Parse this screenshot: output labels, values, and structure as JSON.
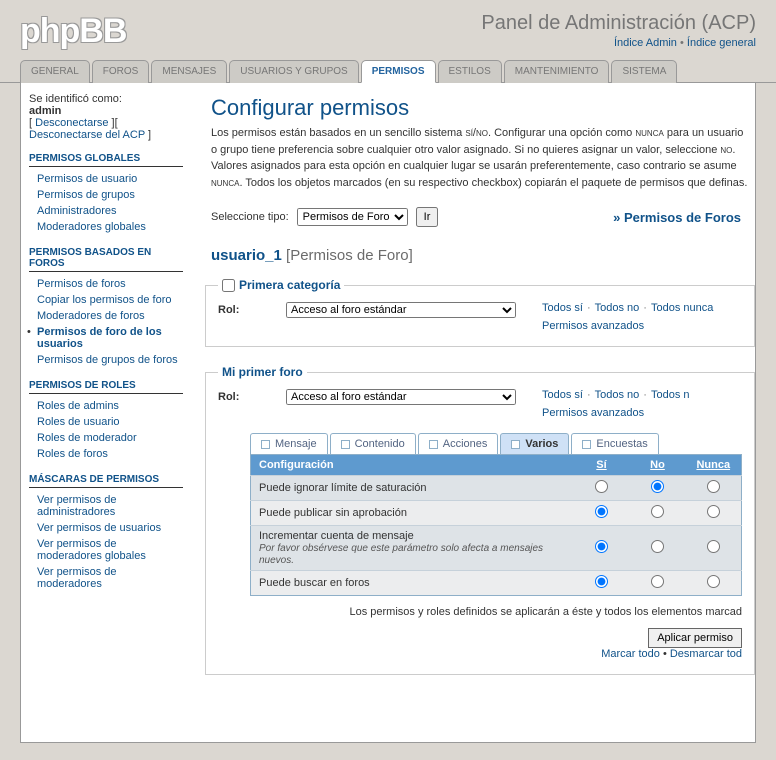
{
  "header": {
    "logo": "phpBB",
    "title": "Panel de Administración (ACP)",
    "link1": "Índice Admin",
    "link2": "Índice general"
  },
  "tabs": [
    "GENERAL",
    "FOROS",
    "MENSAJES",
    "USUARIOS Y GRUPOS",
    "PERMISOS",
    "ESTILOS",
    "MANTENIMIENTO",
    "SISTEMA"
  ],
  "sidebar": {
    "logged_label": "Se identificó como:",
    "user": "admin",
    "logout": "Desconectarse",
    "logout_acp": "Desconectarse del ACP",
    "sections": [
      {
        "title": "PERMISOS GLOBALES",
        "items": [
          "Permisos de usuario",
          "Permisos de grupos",
          "Administradores",
          "Moderadores globales"
        ]
      },
      {
        "title": "PERMISOS BASADOS EN FOROS",
        "items": [
          "Permisos de foros",
          "Copiar los permisos de foro",
          "Moderadores de foros",
          "Permisos de foro de los usuarios",
          "Permisos de grupos de foros"
        ],
        "active": 3
      },
      {
        "title": "PERMISOS DE ROLES",
        "items": [
          "Roles de admins",
          "Roles de usuario",
          "Roles de moderador",
          "Roles de foros"
        ]
      },
      {
        "title": "MÁSCARAS DE PERMISOS",
        "items": [
          "Ver permisos de administradores",
          "Ver permisos de usuarios",
          "Ver permisos de moderadores globales",
          "Ver permisos de moderadores"
        ]
      }
    ]
  },
  "content": {
    "h1": "Configurar permisos",
    "desc_pre": "Los permisos están basados en un sencillo sistema ",
    "sino": "sí/no",
    "desc_mid1": ". Configurar una opción como ",
    "nunca": "nunca",
    "desc_mid2": " para un usuario o grupo tiene preferencia sobre cualquier otro valor asignado. Si no quieres asignar un valor, seleccione ",
    "no": "no",
    "desc_mid3": ". Valores asignados para esta opción en cualquier lugar se usarán preferentemente, caso contrario se asume ",
    "desc_end": ". Todos los objetos marcados (en su respectivo checkbox) copiarán el paquete de permisos que definas.",
    "type_label": "Seleccione tipo:",
    "type_value": "Permisos de Foro",
    "go": "Ir",
    "forum_perms_link": "» Permisos de Foros",
    "h2_user": "usuario_1",
    "h2_suffix": "[Permisos de Foro]",
    "cat1": {
      "legend": "Primera categoría",
      "role_label": "Rol:",
      "role_value": "Acceso al foro estándar",
      "all_si": "Todos sí",
      "all_no": "Todos no",
      "all_nunca": "Todos nunca",
      "adv": "Permisos avanzados"
    },
    "cat2": {
      "legend": "Mi primer foro",
      "role_label": "Rol:",
      "role_value": "Acceso al foro estándar",
      "all_si": "Todos sí",
      "all_no": "Todos no",
      "all_nunca": "Todos n",
      "adv": "Permisos avanzados"
    },
    "ptabs": [
      "Mensaje",
      "Contenido",
      "Acciones",
      "Varios",
      "Encuestas"
    ],
    "table": {
      "h_config": "Configuración",
      "h_si": "Sí",
      "h_no": "No",
      "h_nunca": "Nunca",
      "rows": [
        {
          "label": "Puede ignorar límite de saturación",
          "sel": 1
        },
        {
          "label": "Puede publicar sin aprobación",
          "sel": 0
        },
        {
          "label": "Incrementar cuenta de mensaje",
          "hint": "Por favor obsérvese que este parámetro solo afecta a mensajes nuevos.",
          "sel": 0
        },
        {
          "label": "Puede buscar en foros",
          "sel": 0
        }
      ]
    },
    "footer_note": "Los permisos y roles definidos se aplicarán a éste y todos los elementos marcad",
    "apply_btn": "Aplicar permiso",
    "mark_all": "Marcar todo",
    "unmark_all": "Desmarcar tod"
  }
}
